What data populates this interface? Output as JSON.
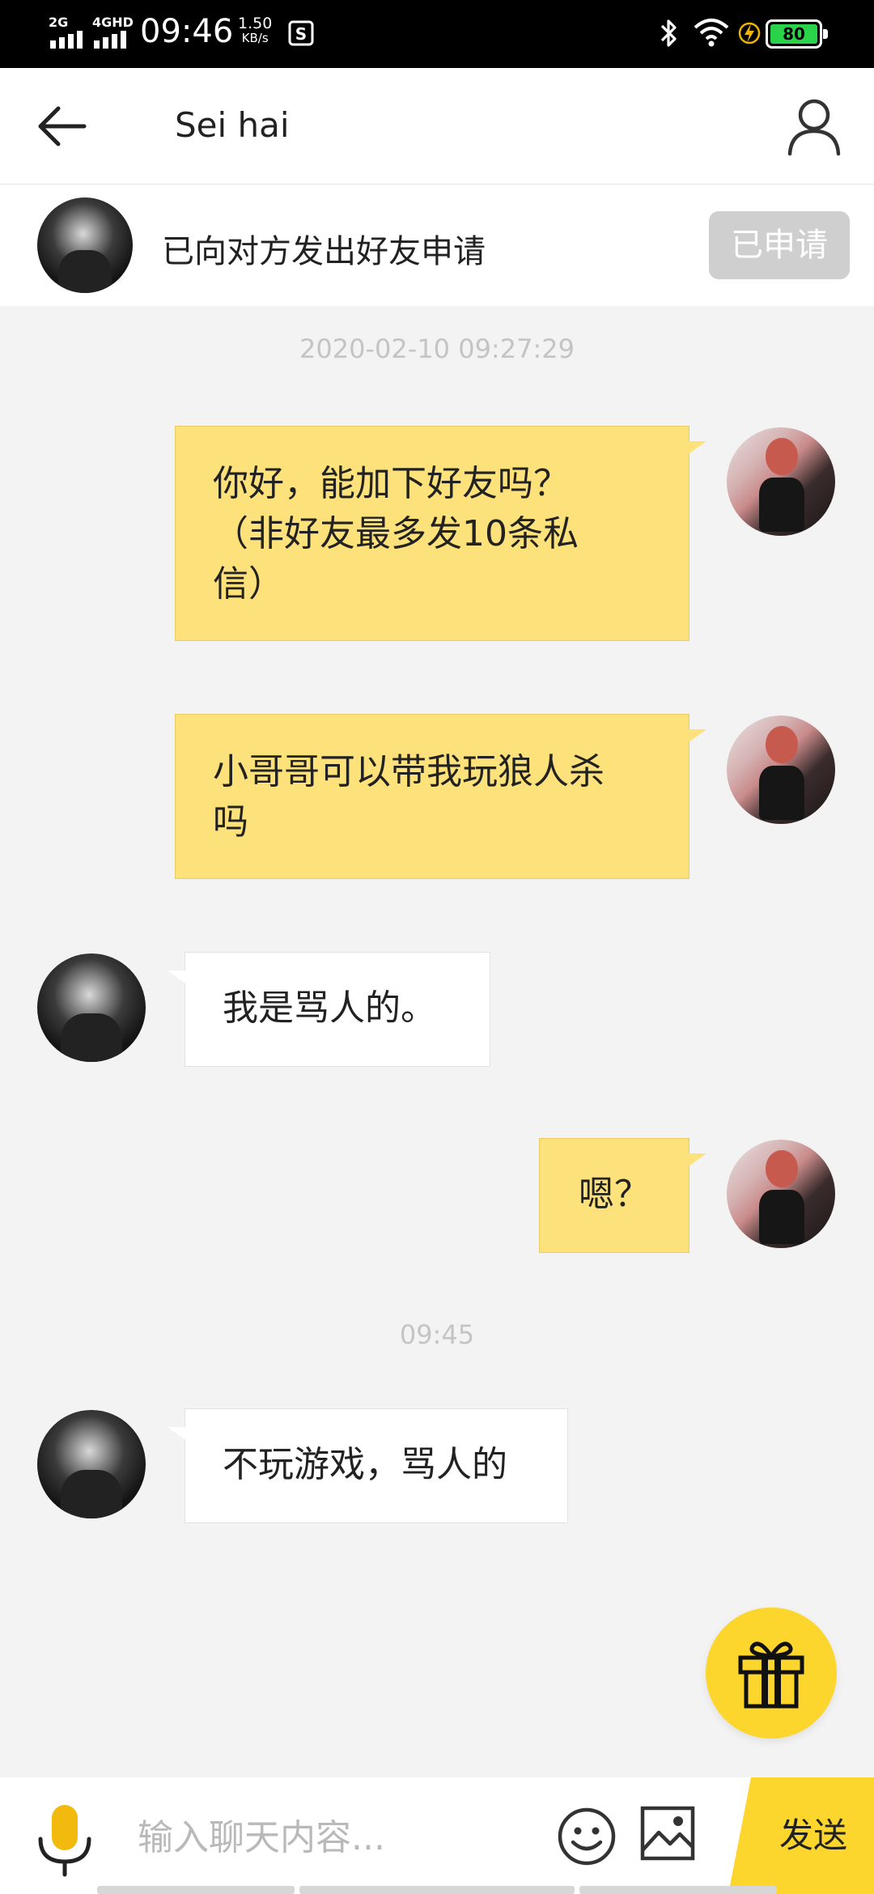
{
  "status_bar": {
    "network_1": "2G",
    "network_2": "4GHD",
    "time": "09:46",
    "speed_value": "1.50",
    "speed_unit": "KB/s",
    "battery": "80",
    "icons": [
      "signal-icon",
      "bluetooth-icon",
      "wifi-icon",
      "charging-icon",
      "battery-icon"
    ]
  },
  "header": {
    "title": "Sei hai",
    "back_icon": "arrow-left-icon",
    "profile_icon": "person-icon"
  },
  "friend_banner": {
    "text": "已向对方发出好友申请",
    "button": "已申请"
  },
  "messages": [
    {
      "type": "timestamp",
      "text": "2020-02-10 09:27:29"
    },
    {
      "type": "outgoing",
      "lines": [
        "你好，能加下好友吗？",
        "（非好友最多发10条私",
        "信）"
      ]
    },
    {
      "type": "outgoing",
      "lines": [
        "小哥哥可以带我玩狼人杀",
        "吗"
      ]
    },
    {
      "type": "incoming",
      "text": "我是骂人的。"
    },
    {
      "type": "outgoing",
      "text": "嗯？"
    },
    {
      "type": "timestamp",
      "text": "09:45"
    },
    {
      "type": "incoming",
      "text": "不玩游戏，骂人的"
    }
  ],
  "composer": {
    "placeholder": "输入聊天内容...",
    "send_label": "发送",
    "icons": [
      "microphone-icon",
      "emoji-icon",
      "image-icon",
      "gift-icon"
    ]
  },
  "colors": {
    "accent": "#fcd52d",
    "outgoing_bubble": "#fde17b",
    "incoming_bubble": "#ffffff",
    "background": "#f3f3f3"
  }
}
